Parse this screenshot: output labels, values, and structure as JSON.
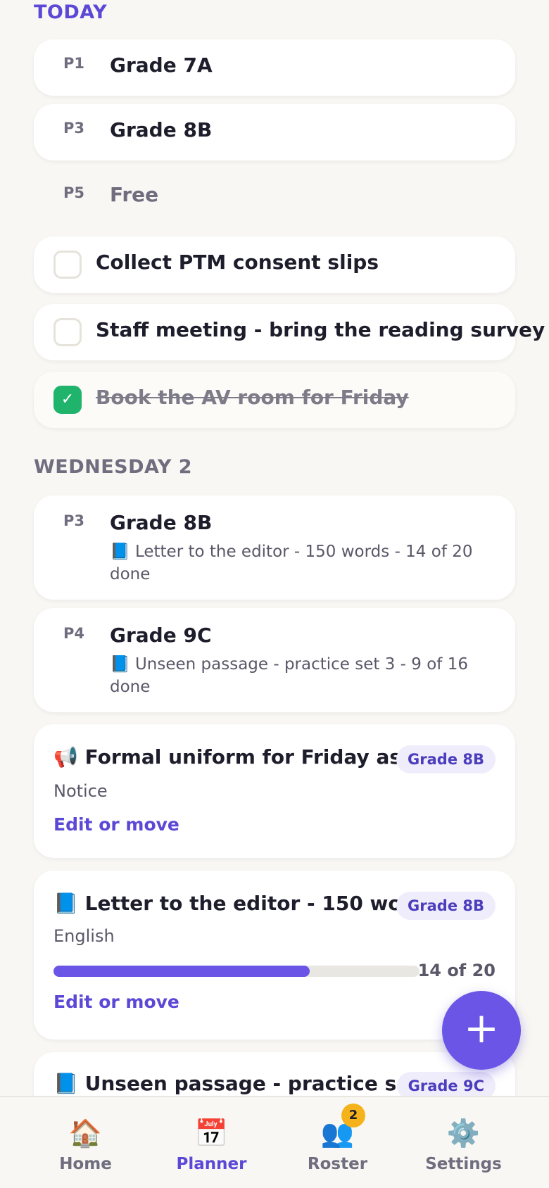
{
  "today": {
    "heading": "TODAY",
    "periods": [
      {
        "period": "P1",
        "class": "Grade 7A"
      },
      {
        "period": "P3",
        "class": "Grade 8B"
      },
      {
        "period": "P5",
        "class": "Free"
      }
    ],
    "tasks": [
      {
        "label": "Collect PTM consent slips",
        "done": false
      },
      {
        "label": "Staff meeting - bring the reading survey",
        "done": false
      },
      {
        "label": "Book the AV room for Friday",
        "done": true,
        "check": "✓"
      }
    ]
  },
  "wednesday": {
    "heading": "WEDNESDAY 2",
    "periods": [
      {
        "period": "P3",
        "class": "Grade 8B",
        "detail": "📘 Letter to the editor - 150 words - 14 of 20 done"
      },
      {
        "period": "P4",
        "class": "Grade 9C",
        "detail": "📘 Unseen passage - practice set 3 - 9 of 16 done"
      }
    ],
    "items": [
      {
        "title": "📢 Formal uniform for Friday as...",
        "chip": "Grade 8B",
        "subtitle": "Notice",
        "action": "Edit or move"
      },
      {
        "title": "📘 Letter to the editor - 150 wo...",
        "chip": "Grade 8B",
        "subtitle": "English",
        "progress_label": "14 of 20",
        "progress": 0.7,
        "action": "Edit or move"
      },
      {
        "title": "📘 Unseen passage - practice se...",
        "chip": "Grade 9C"
      }
    ]
  },
  "fab": {
    "icon": "plus-icon",
    "glyph": "+"
  },
  "tabbar": {
    "tabs": [
      {
        "label": "Home",
        "icon": "house-icon",
        "glyph": "🏠"
      },
      {
        "label": "Planner",
        "icon": "calendar-icon",
        "glyph": "📅",
        "active": true
      },
      {
        "label": "Roster",
        "icon": "people-icon",
        "glyph": "👥",
        "badge": "2"
      },
      {
        "label": "Settings",
        "icon": "gear-icon",
        "glyph": "⚙️"
      }
    ]
  },
  "colors": {
    "accent": "#5b48d6",
    "today_heading": "#5b48d6",
    "section_heading": "#6f6d7e",
    "done_check": "#1fb36c",
    "badge": "#f5b21b"
  }
}
